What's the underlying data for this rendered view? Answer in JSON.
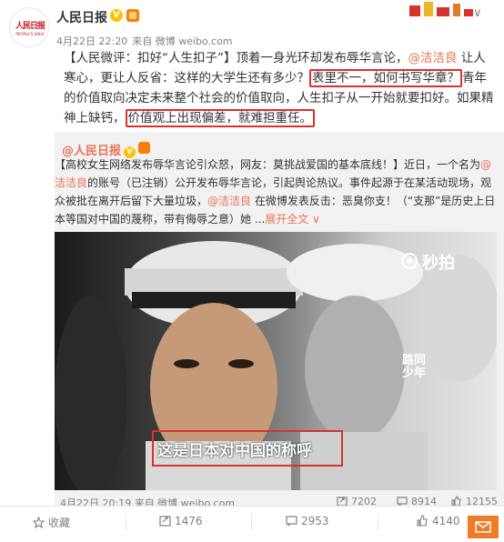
{
  "post": {
    "user_name": "人民日报",
    "avatar_logo": "人民日报",
    "avatar_sub": "PEOPLE'S DAILY",
    "time": "4月22日 22:20",
    "source": "来自 微博 weibo.com",
    "text_1": "【人民微评：扣好“人生扣子”】顶着一身光环却发布辱华言论，",
    "mention_1": "@洁洁良",
    "text_2": " 让人寒心，更让人反省：这样的大学生还有多少？",
    "highlight_1": "表里不一，如何书写华章？",
    "text_3": "青年的价值取向决定未来整个社会的价值取向，人生扣子从一开始就要扣好。如果精神上缺钙，",
    "highlight_2": "价值观上出现偏差，就难担重任。"
  },
  "repost": {
    "user_name": "@人民日报",
    "text_1": "【高校女生网络发布辱华言论引众怒，网友：莫挑战爱国的基本底线！】近日，一个名为",
    "mention_1": "@洁洁良",
    "text_2": "的账号（已注销）公开发布辱华言论，引起舆论热议。事件起源于在某活动现场，观众被批在离开后留下大量垃圾，",
    "mention_2": "@洁洁良",
    "text_3": " 在微博发表反击：恶臭你支！（“支那”是历史上日本等国对中国的蔑称，带有侮辱之意）她 ...",
    "expand_label": "展开全文 ∨",
    "video": {
      "watermark": "秒拍",
      "side_caption": "路同少年",
      "subtitle": "这是日本对中国的称呼"
    },
    "time": "4月22日 20:19 来自 微博 weibo.com",
    "forward_count": "7202",
    "comment_count": "8914",
    "like_count": "12155"
  },
  "actions": {
    "favorite_label": "收藏",
    "forward_count": "1476",
    "comment_count": "2953",
    "like_count": "4140"
  },
  "colors": {
    "accent": "#eb7350",
    "highlight_box": "#d9312c",
    "repost_bg": "#f2f2f5",
    "vip_badge": "#ffc200"
  }
}
